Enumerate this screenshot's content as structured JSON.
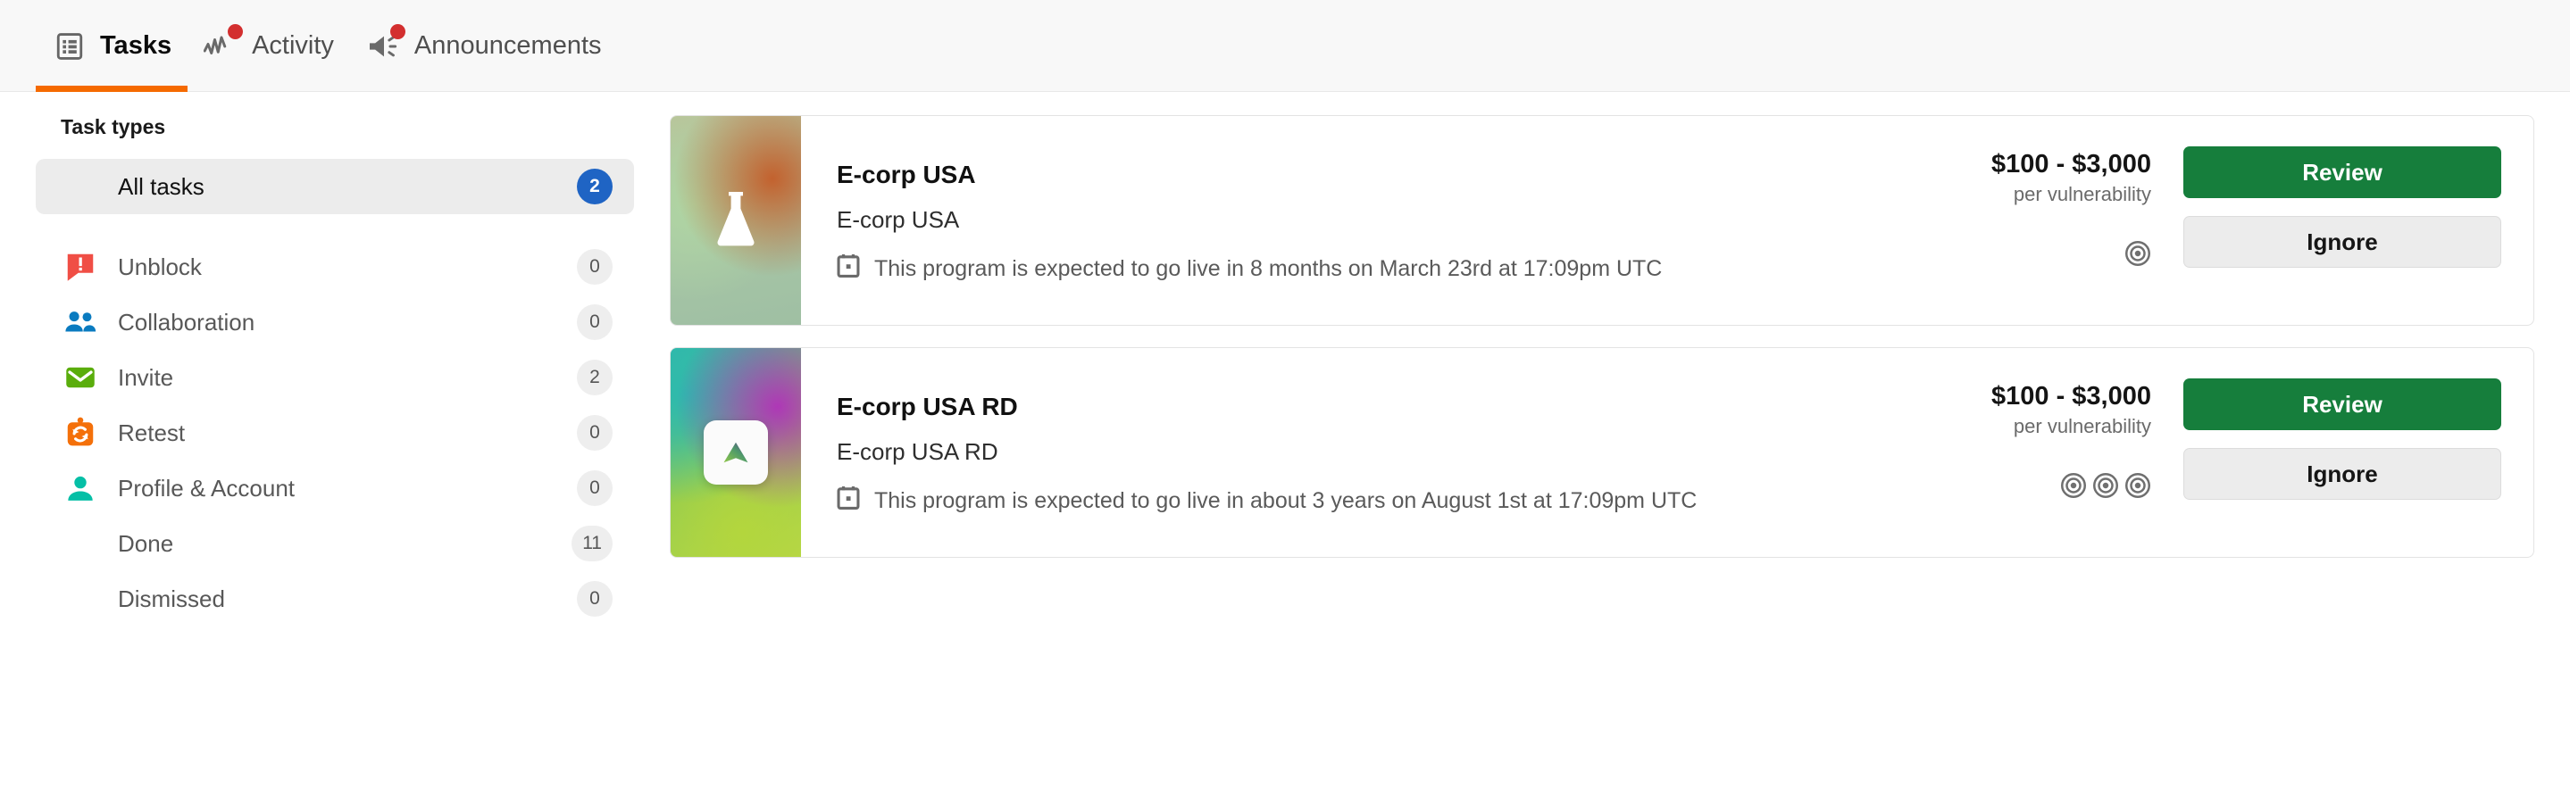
{
  "header": {
    "tabs": [
      {
        "label": "Tasks",
        "icon": "list-icon",
        "active": true,
        "has_notification": false
      },
      {
        "label": "Activity",
        "icon": "activity-pulse-icon",
        "active": false,
        "has_notification": true
      },
      {
        "label": "Announcements",
        "icon": "megaphone-icon",
        "active": false,
        "has_notification": true
      }
    ],
    "active_tab_underline_color": "#f56a00",
    "notification_dot_color": "#d32f2f"
  },
  "sidebar": {
    "title": "Task types",
    "items": [
      {
        "label": "All tasks",
        "count": "2",
        "icon": null,
        "selected": true,
        "badge_accent": true
      },
      {
        "label": "Unblock",
        "count": "0",
        "icon": "alert-bubble-icon",
        "selected": false,
        "badge_accent": false
      },
      {
        "label": "Collaboration",
        "count": "0",
        "icon": "people-icon",
        "selected": false,
        "badge_accent": false
      },
      {
        "label": "Invite",
        "count": "2",
        "icon": "envelope-icon",
        "selected": false,
        "badge_accent": false
      },
      {
        "label": "Retest",
        "count": "0",
        "icon": "retest-refresh-icon",
        "selected": false,
        "badge_accent": false
      },
      {
        "label": "Profile & Account",
        "count": "0",
        "icon": "person-icon",
        "selected": false,
        "badge_accent": false
      },
      {
        "label": "Done",
        "count": "11",
        "icon": null,
        "selected": false,
        "badge_accent": false
      },
      {
        "label": "Dismissed",
        "count": "0",
        "icon": null,
        "selected": false,
        "badge_accent": false
      }
    ],
    "accent_badge_color": "#1f64c4",
    "selected_row_color": "#ececec"
  },
  "tasks": [
    {
      "title": "E-corp USA",
      "subtitle": "E-corp USA",
      "meta_icon": "calendar-icon",
      "meta": "This program is expected to go live in 8 months on March 23rd at 17:09pm UTC",
      "price": "$100 - $3,000",
      "price_unit": "per vulnerability",
      "target_count": 1,
      "logo_icon": "flask-icon",
      "review_label": "Review",
      "ignore_label": "Ignore"
    },
    {
      "title": "E-corp USA RD",
      "subtitle": "E-corp USA RD",
      "meta_icon": "calendar-icon",
      "meta": "This program is expected to go live in about 3 years on August 1st at 17:09pm UTC",
      "price": "$100 - $3,000",
      "price_unit": "per vulnerability",
      "target_count": 3,
      "logo_icon": "triangle-tile-icon",
      "review_label": "Review",
      "ignore_label": "Ignore"
    }
  ],
  "colors": {
    "review_button": "#167e3c",
    "ignore_button": "#ececec",
    "tab_underline": "#f56a00"
  }
}
